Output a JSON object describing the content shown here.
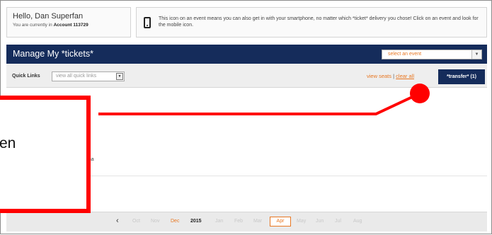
{
  "greeting": {
    "title": "Hello, Dan Superfan",
    "account_prefix": "You are currently in ",
    "account": "Account 113729"
  },
  "mobile_notice": {
    "icon": "smartphone-icon",
    "text": "This icon on an event means you can also get in with your smartphone, no matter which *ticket* delivery you chose! Click on an event and look for the mobile icon."
  },
  "manage": {
    "title": "Manage My *tickets*",
    "event_select_placeholder": "select an event",
    "event_select_arrow": "▼"
  },
  "quick_links": {
    "label": "Quick Links",
    "select_value": "view all quick links",
    "select_arrow": "▼",
    "view_seats": "view seats",
    "separator": "|",
    "clear_all": "clear all",
    "transfer_button": "*transfer* (1)"
  },
  "content": {
    "venue_fragment": "ena"
  },
  "timeline": {
    "prev_arrow": "‹",
    "months_before": [
      "Oct",
      "Nov"
    ],
    "dec": "Dec",
    "year": "2015",
    "months_mid": [
      "Jan",
      "Feb",
      "Mar"
    ],
    "selected": "Apr",
    "months_after": [
      "May",
      "Jun",
      "Jul",
      "Aug"
    ]
  },
  "callout": {
    "text": "en"
  },
  "colors": {
    "brand_navy": "#152c5b",
    "accent_orange": "#e87722",
    "callout_red": "#ff0000"
  }
}
